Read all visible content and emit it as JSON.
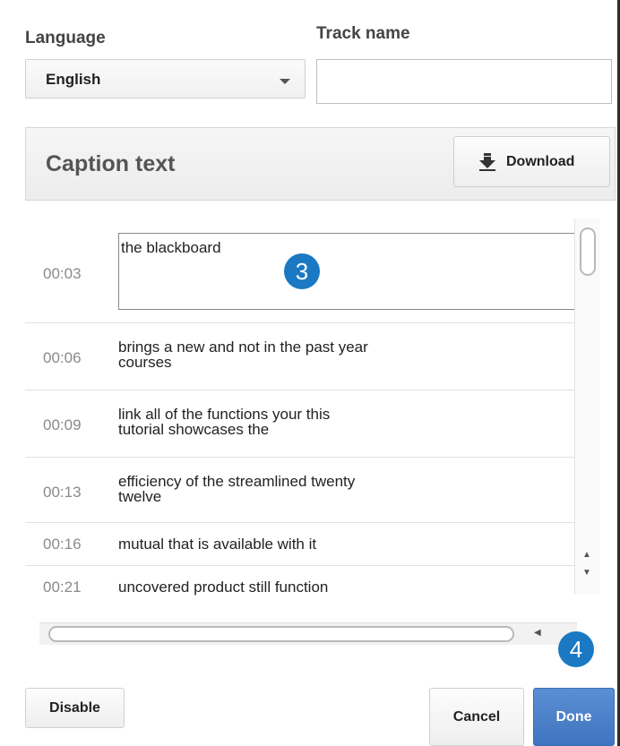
{
  "form": {
    "language_label": "Language",
    "language_value": "English",
    "track_name_label": "Track name",
    "track_name_value": ""
  },
  "captions": {
    "title": "Caption text",
    "download_label": "Download",
    "active_row": {
      "time": "00:03",
      "text": "the blackboard"
    },
    "rows": [
      {
        "time": "00:06",
        "line1": "brings a new and not in the past year",
        "line2": "courses"
      },
      {
        "time": "00:09",
        "line1": "link all of the functions your this",
        "line2": "tutorial showcases the"
      },
      {
        "time": "00:13",
        "line1": "efficiency of the streamlined twenty",
        "line2": "twelve"
      },
      {
        "time": "00:16",
        "line1": "mutual that is available with it",
        "line2": ""
      },
      {
        "time": "00:21",
        "line1": "uncovered product still function",
        "line2": ""
      }
    ]
  },
  "annotations": {
    "step3": "3",
    "step4": "4",
    "badge_color": "#1a79c2"
  },
  "footer": {
    "disable_label": "Disable",
    "cancel_label": "Cancel",
    "done_label": "Done",
    "done_color": "#4a80c9"
  },
  "icons": {
    "download": "download-arrow-icon",
    "dropdown": "chevron-down-icon"
  }
}
